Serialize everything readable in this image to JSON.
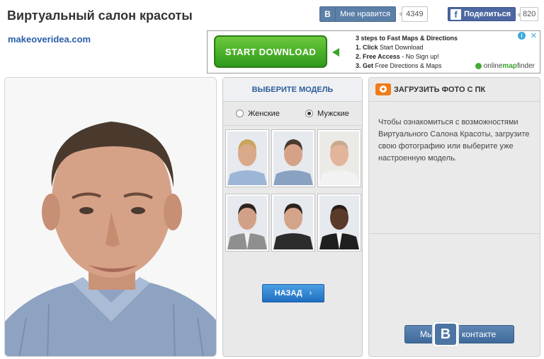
{
  "header": {
    "title": "Виртуальный салон красоты",
    "site_link": "makeoveridea.com"
  },
  "social": {
    "vk_letter": "В",
    "vk_like_label": "Мне нравится",
    "vk_like_count": "4349",
    "fb_letter": "f",
    "fb_share_label": "Поделиться",
    "fb_share_count": "820"
  },
  "ad": {
    "button_label": "START DOWNLOAD",
    "line1": "3 steps to Fast Maps & Directions",
    "line2_bold": "1. Click",
    "line2_rest": " Start Download",
    "line3_bold": "2. Free Access",
    "line3_rest": " - No Sign up!",
    "line4_bold": "3. Get",
    "line4_rest": " Free Directions & Maps",
    "brand_prefix": "online",
    "brand_map": "map",
    "brand_suffix": "finder",
    "info_glyph": "i",
    "close_glyph": "✕"
  },
  "model_panel": {
    "heading": "ВЫБЕРИТЕ МОДЕЛЬ",
    "option_female": "Женские",
    "option_male": "Мужские",
    "selected": "male",
    "back_label": "НАЗАД",
    "back_chevron": "›"
  },
  "upload_panel": {
    "heading": "ЗАГРУЗИТЬ ФОТО С ПК",
    "description": "Чтобы ознакомиться с возможностями Виртуального Салона Красоты, загрузите свою фотографию или выберите уже настроенную модель.",
    "vk_left": "Мы",
    "vk_logo": "В",
    "vk_right": "контакте"
  },
  "colors": {
    "accent_blue": "#2e5c9a",
    "vk_blue": "#5b7fa6",
    "fb_blue": "#4c67a1",
    "ad_green": "#3aa52a",
    "camera_orange": "#f07c1a"
  }
}
